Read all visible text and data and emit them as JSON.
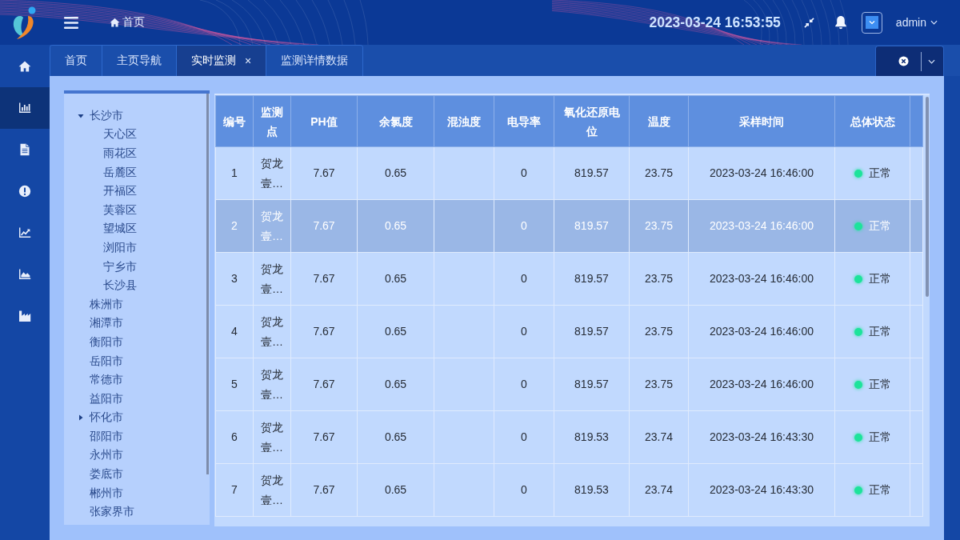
{
  "header": {
    "breadcrumb": "首页",
    "datetime": "2023-03-24 16:53:55",
    "user": "admin"
  },
  "sidebar": {
    "items": [
      {
        "selected": false
      },
      {
        "selected": true
      },
      {
        "selected": false
      },
      {
        "selected": false
      },
      {
        "selected": false
      },
      {
        "selected": false
      },
      {
        "selected": false
      }
    ]
  },
  "tabs": [
    {
      "label": "首页",
      "selected": false
    },
    {
      "label": "主页导航",
      "selected": false
    },
    {
      "label": "实时监测",
      "selected": true,
      "close": "×"
    },
    {
      "label": "监测详情数据",
      "selected": false
    }
  ],
  "tree": {
    "items": [
      {
        "label": "长沙市",
        "kind": "group",
        "expanded": true,
        "children": [
          {
            "label": "天心区"
          },
          {
            "label": "雨花区"
          },
          {
            "label": "岳麓区"
          },
          {
            "label": "开福区"
          },
          {
            "label": "芙蓉区"
          },
          {
            "label": "望城区"
          },
          {
            "label": "浏阳市"
          },
          {
            "label": "宁乡市"
          },
          {
            "label": "长沙县"
          }
        ]
      },
      {
        "label": "株洲市",
        "kind": "leaf"
      },
      {
        "label": "湘潭市",
        "kind": "leaf"
      },
      {
        "label": "衡阳市",
        "kind": "leaf"
      },
      {
        "label": "岳阳市",
        "kind": "leaf"
      },
      {
        "label": "常德市",
        "kind": "leaf"
      },
      {
        "label": "益阳市",
        "kind": "leaf"
      },
      {
        "label": "怀化市",
        "kind": "group",
        "expanded": false
      },
      {
        "label": "邵阳市",
        "kind": "leaf"
      },
      {
        "label": "永州市",
        "kind": "leaf"
      },
      {
        "label": "娄底市",
        "kind": "leaf"
      },
      {
        "label": "郴州市",
        "kind": "leaf"
      },
      {
        "label": "张家界市",
        "kind": "leaf"
      }
    ]
  },
  "table": {
    "columns": [
      "编号",
      "监测点",
      "PH值",
      "余氯度",
      "混浊度",
      "电导率",
      "氧化还原电位",
      "温度",
      "采样时间",
      "总体状态"
    ],
    "rows": [
      {
        "selected": false,
        "no": "1",
        "site": "贺龙壹…",
        "ph": "7.67",
        "residual_chlorine": "0.65",
        "conductivity": "0",
        "orp": "819.57",
        "temperature": "23.75",
        "sample_time": "2023-03-24 16:46:00",
        "status": {
          "text": "正常",
          "color": "#1de39b"
        }
      },
      {
        "selected": true,
        "no": "2",
        "site": "贺龙壹…",
        "ph": "7.67",
        "residual_chlorine": "0.65",
        "conductivity": "0",
        "orp": "819.57",
        "temperature": "23.75",
        "sample_time": "2023-03-24 16:46:00",
        "status": {
          "text": "正常",
          "color": "#1de39b"
        }
      },
      {
        "selected": false,
        "no": "3",
        "site": "贺龙壹…",
        "ph": "7.67",
        "residual_chlorine": "0.65",
        "conductivity": "0",
        "orp": "819.57",
        "temperature": "23.75",
        "sample_time": "2023-03-24 16:46:00",
        "status": {
          "text": "正常",
          "color": "#1de39b"
        }
      },
      {
        "selected": false,
        "no": "4",
        "site": "贺龙壹…",
        "ph": "7.67",
        "residual_chlorine": "0.65",
        "conductivity": "0",
        "orp": "819.57",
        "temperature": "23.75",
        "sample_time": "2023-03-24 16:46:00",
        "status": {
          "text": "正常",
          "color": "#1de39b"
        }
      },
      {
        "selected": false,
        "no": "5",
        "site": "贺龙壹…",
        "ph": "7.67",
        "residual_chlorine": "0.65",
        "conductivity": "0",
        "orp": "819.57",
        "temperature": "23.75",
        "sample_time": "2023-03-24 16:46:00",
        "status": {
          "text": "正常",
          "color": "#1de39b"
        }
      },
      {
        "selected": false,
        "no": "6",
        "site": "贺龙壹…",
        "ph": "7.67",
        "residual_chlorine": "0.65",
        "conductivity": "0",
        "orp": "819.53",
        "temperature": "23.74",
        "sample_time": "2023-03-24 16:43:30",
        "status": {
          "text": "正常",
          "color": "#1de39b"
        }
      },
      {
        "selected": false,
        "no": "7",
        "site": "贺龙壹…",
        "ph": "7.67",
        "residual_chlorine": "0.65",
        "conductivity": "0",
        "orp": "819.53",
        "temperature": "23.74",
        "sample_time": "2023-03-24 16:43:30",
        "status": {
          "text": "正常",
          "color": "#1de39b"
        }
      }
    ]
  }
}
